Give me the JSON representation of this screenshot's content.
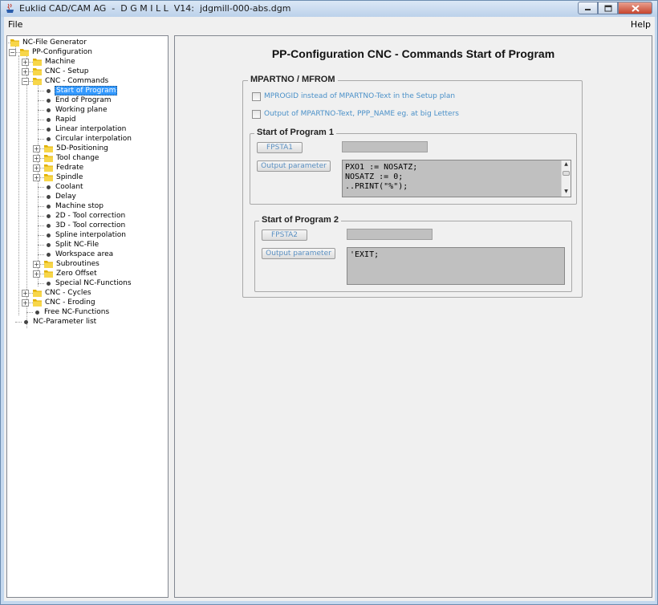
{
  "window": {
    "title": "Euklid CAD/CAM AG  -  D G M I L L  V14:  jdgmill-000-abs.dgm",
    "minimize_icon": "minimize-icon",
    "maximize_icon": "maximize-icon",
    "close_icon": "close-icon"
  },
  "menu": {
    "file": "File",
    "help": "Help"
  },
  "tree": {
    "items": [
      {
        "label": "NC-File Generator"
      },
      {
        "label": "PP-Configuration"
      },
      {
        "label": "Machine"
      },
      {
        "label": "CNC - Setup"
      },
      {
        "label": "CNC - Commands"
      },
      {
        "label": "Start of Program"
      },
      {
        "label": "End of Program"
      },
      {
        "label": "Working plane"
      },
      {
        "label": "Rapid"
      },
      {
        "label": "Linear interpolation"
      },
      {
        "label": "Circular interpolation"
      },
      {
        "label": "5D-Positioning"
      },
      {
        "label": "Tool change"
      },
      {
        "label": "Fedrate"
      },
      {
        "label": "Spindle"
      },
      {
        "label": "Coolant"
      },
      {
        "label": "Delay"
      },
      {
        "label": "Machine stop"
      },
      {
        "label": "2D - Tool correction"
      },
      {
        "label": "3D - Tool correction"
      },
      {
        "label": "Spline interpolation"
      },
      {
        "label": "Split NC-File"
      },
      {
        "label": "Workspace area"
      },
      {
        "label": "Subroutines"
      },
      {
        "label": "Zero Offset"
      },
      {
        "label": "Special NC-Functions"
      },
      {
        "label": "CNC - Cycles"
      },
      {
        "label": "CNC - Eroding"
      },
      {
        "label": "Free NC-Functions"
      },
      {
        "label": "NC-Parameter list"
      }
    ]
  },
  "content": {
    "title": "PP-Configuration CNC - Commands Start of Program",
    "group_main": "MPARTNO / MFROM",
    "checkbox1": "MPROGID instead of MPARTNO-Text in the Setup plan",
    "checkbox2": "Output of MPARTNO-Text, PPP_NAME eg. at big Letters",
    "program1": {
      "title": "Start of Program 1",
      "fpsta_button": "FPSTA1",
      "output_button": "Output parameter",
      "field_value": "",
      "code": "PXO1 := NOSATZ;\nNOSATZ := 0;\n..PRINT(\"%\");"
    },
    "program2": {
      "title": "Start of Program 2",
      "fpsta_button": "FPSTA2",
      "output_button": "Output parameter",
      "field_value": "",
      "code": "'EXIT;"
    }
  }
}
